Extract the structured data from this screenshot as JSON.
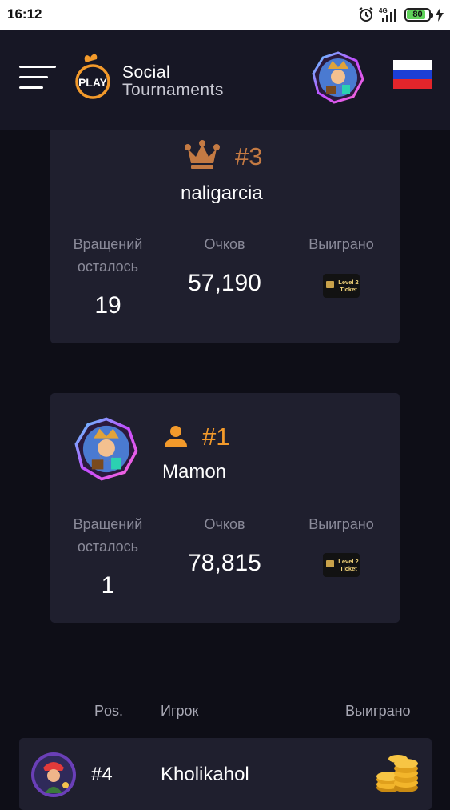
{
  "status_bar": {
    "time": "16:12",
    "network": "4G",
    "battery": "80"
  },
  "header": {
    "brand_line1": "Social",
    "brand_line2": "Tournaments",
    "logo_text": "PLAY"
  },
  "colors": {
    "accent": "#f39a2b",
    "bronze": "#c47a43",
    "card_bg": "#1f1f2e",
    "header_bg": "#171725",
    "page_bg": "#0e0e17"
  },
  "third_place": {
    "icon": "crown-icon",
    "rank": "#3",
    "name": "naligarcia",
    "spins_label_1": "Вращений",
    "spins_label_2": "осталось",
    "spins_value": "19",
    "points_label": "Очков",
    "points_value": "57,190",
    "won_label": "Выиграно",
    "prize_line1": "Level 2",
    "prize_line2": "Ticket"
  },
  "current_player": {
    "icon": "user-icon",
    "rank": "#1",
    "name": "Mamon",
    "spins_label_1": "Вращений",
    "spins_label_2": "осталось",
    "spins_value": "1",
    "points_label": "Очков",
    "points_value": "78,815",
    "won_label": "Выиграно",
    "prize_line1": "Level 2",
    "prize_line2": "Ticket"
  },
  "leaderboard": {
    "col_pos": "Pos.",
    "col_player": "Игрок",
    "col_won": "Выиграно",
    "rows": [
      {
        "pos": "#4",
        "name": "Kholikahol",
        "prize_icon": "coins-icon"
      }
    ]
  }
}
